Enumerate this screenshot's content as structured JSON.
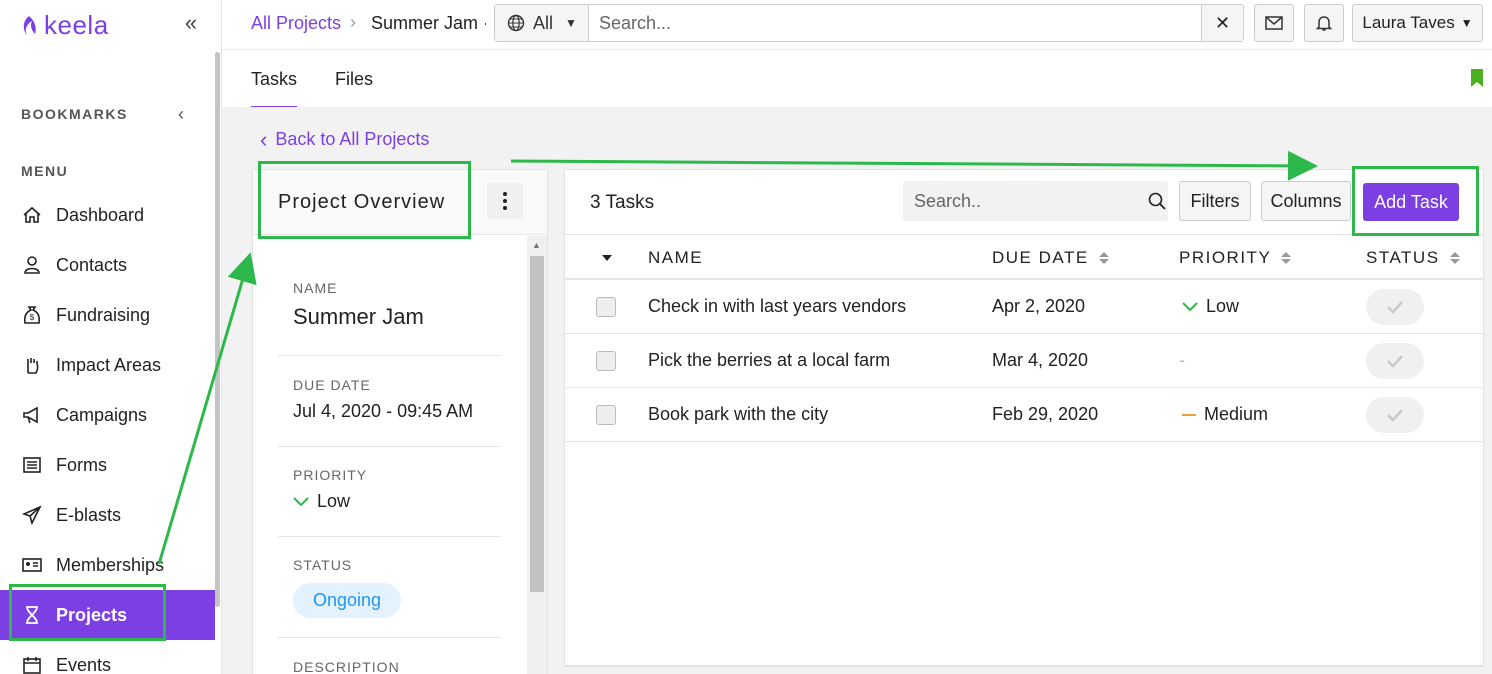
{
  "app": {
    "logo_text": "keela"
  },
  "sidebar": {
    "bookmarks_heading": "BOOKMARKS",
    "menu_heading": "MENU",
    "items": [
      {
        "label": "Dashboard",
        "icon": "home-icon"
      },
      {
        "label": "Contacts",
        "icon": "person-icon"
      },
      {
        "label": "Fundraising",
        "icon": "money-bag-icon"
      },
      {
        "label": "Impact Areas",
        "icon": "hand-icon"
      },
      {
        "label": "Campaigns",
        "icon": "megaphone-icon"
      },
      {
        "label": "Forms",
        "icon": "list-icon"
      },
      {
        "label": "E-blasts",
        "icon": "paper-plane-icon"
      },
      {
        "label": "Memberships",
        "icon": "id-card-icon"
      },
      {
        "label": "Projects",
        "icon": "hourglass-icon",
        "active": true
      },
      {
        "label": "Events",
        "icon": "calendar-icon"
      }
    ]
  },
  "topbar": {
    "breadcrumb_parent": "All Projects",
    "breadcrumb_current": "Summer Jam ·",
    "scope_label": "All",
    "search_placeholder": "Search...",
    "user_name": "Laura Taves"
  },
  "tabs": [
    {
      "label": "Tasks",
      "active": true
    },
    {
      "label": "Files",
      "active": false
    }
  ],
  "back_link": "Back to All Projects",
  "overview": {
    "title": "Project Overview",
    "fields": {
      "name_label": "NAME",
      "name_value": "Summer Jam",
      "due_label": "DUE DATE",
      "due_value": "Jul 4, 2020 - 09:45 AM",
      "priority_label": "PRIORITY",
      "priority_value": "Low",
      "status_label": "STATUS",
      "status_value": "Ongoing",
      "description_label": "DESCRIPTION"
    }
  },
  "tasks": {
    "count_label": "3 Tasks",
    "search_placeholder": "Search..",
    "filters_label": "Filters",
    "columns_label": "Columns",
    "add_label": "Add Task",
    "headers": {
      "name": "NAME",
      "due": "DUE DATE",
      "priority": "PRIORITY",
      "status": "STATUS"
    },
    "rows": [
      {
        "name": "Check in with last years vendors",
        "due": "Apr 2, 2020",
        "priority": "Low"
      },
      {
        "name": "Pick the berries at a local farm",
        "due": "Mar 4, 2020",
        "priority": "-"
      },
      {
        "name": "Book park with the city",
        "due": "Feb 29, 2020",
        "priority": "Medium"
      }
    ]
  },
  "colors": {
    "accent": "#7b3fe4",
    "annotation": "#2db84b",
    "low": "#2db84b",
    "medium": "#e6a23c",
    "status_pill": "#2196f3"
  }
}
